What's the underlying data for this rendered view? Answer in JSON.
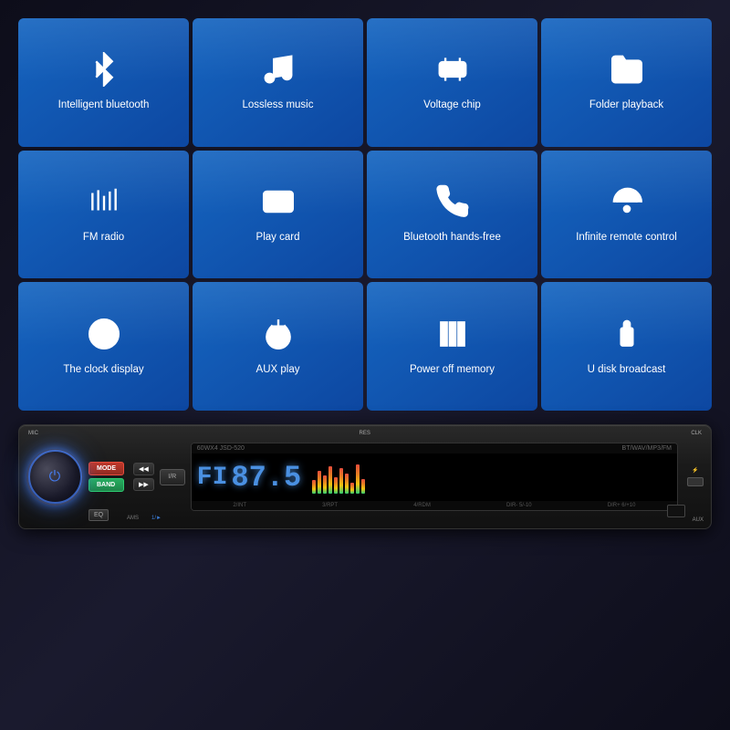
{
  "features": [
    {
      "id": "intelligent-bluetooth",
      "label": "Intelligent\nbluetooth",
      "icon": "bluetooth"
    },
    {
      "id": "lossless-music",
      "label": "Lossless music",
      "icon": "music"
    },
    {
      "id": "voltage-chip",
      "label": "Voltage chip",
      "icon": "voltage"
    },
    {
      "id": "folder-playback",
      "label": "Folder playback",
      "icon": "folder"
    },
    {
      "id": "fm-radio",
      "label": "FM radio",
      "icon": "radio"
    },
    {
      "id": "play-card",
      "label": "Play card",
      "icon": "card"
    },
    {
      "id": "bluetooth-handsfree",
      "label": "Bluetooth\nhands-free",
      "icon": "handsfree"
    },
    {
      "id": "infinite-remote",
      "label": "Infinite remote\ncontrol",
      "icon": "remote"
    },
    {
      "id": "clock-display",
      "label": "The clock display",
      "icon": "clock"
    },
    {
      "id": "aux-play",
      "label": "AUX play",
      "icon": "aux"
    },
    {
      "id": "power-off-memory",
      "label": "Power off memory",
      "icon": "memory"
    },
    {
      "id": "u-disk-broadcast",
      "label": "U disk broadcast",
      "icon": "udisk"
    }
  ],
  "radio": {
    "model": "60WX4  JSD-520",
    "bt_label": "BT/WAV/MP3/FM",
    "mic_label": "MIC",
    "res_label": "RES",
    "clk_label": "CLK",
    "mode_label": "MODE",
    "band_label": "BAND",
    "eq_label": "EQ",
    "ams_label": "AMS",
    "play_label": "1/►",
    "ir_label": "I/R",
    "display": {
      "fi": "FI",
      "freq": "87.5",
      "bottom_items": [
        "2/INT",
        "3/RPT",
        "4/RDM",
        "DIR-  5/-10",
        "DIR+  6/+10"
      ]
    }
  }
}
